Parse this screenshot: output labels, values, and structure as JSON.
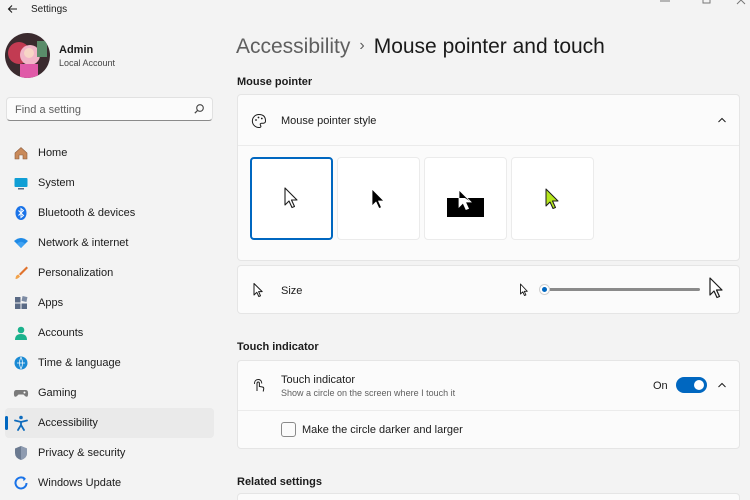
{
  "window": {
    "title": "Settings"
  },
  "user": {
    "name": "Admin",
    "account_type": "Local Account"
  },
  "search": {
    "placeholder": "Find a setting"
  },
  "sidebar": {
    "items": [
      {
        "label": "Home",
        "icon": "home-icon",
        "color": "#c2703d"
      },
      {
        "label": "System",
        "icon": "system-icon",
        "color": "#0f9ed5"
      },
      {
        "label": "Bluetooth & devices",
        "icon": "bluetooth-icon",
        "color": "#1a73e8"
      },
      {
        "label": "Network & internet",
        "icon": "network-icon",
        "color": "#1e8ae6"
      },
      {
        "label": "Personalization",
        "icon": "personalization-icon",
        "color": "#e0722c"
      },
      {
        "label": "Apps",
        "icon": "apps-icon",
        "color": "#5a6a85"
      },
      {
        "label": "Accounts",
        "icon": "accounts-icon",
        "color": "#1bb28c"
      },
      {
        "label": "Time & language",
        "icon": "time-language-icon",
        "color": "#1a8ad4"
      },
      {
        "label": "Gaming",
        "icon": "gaming-icon",
        "color": "#7a7a7a"
      },
      {
        "label": "Accessibility",
        "icon": "accessibility-icon",
        "color": "#0f6cbd",
        "active": true
      },
      {
        "label": "Privacy & security",
        "icon": "shield-icon",
        "color": "#6b7a90"
      },
      {
        "label": "Windows Update",
        "icon": "windows-update-icon",
        "color": "#1a73e8"
      }
    ]
  },
  "breadcrumb": {
    "parent": "Accessibility",
    "separator": "›",
    "current": "Mouse pointer and touch"
  },
  "sections": {
    "mouse_pointer": {
      "heading": "Mouse pointer",
      "style_card_title": "Mouse pointer style",
      "pointer_styles": [
        "white",
        "black",
        "inverted",
        "custom"
      ],
      "selected_style": "white",
      "custom_color": "#b5e61d",
      "size_label": "Size",
      "size_level": 0.03
    },
    "touch_indicator": {
      "heading": "Touch indicator",
      "title": "Touch indicator",
      "description": "Show a circle on the screen where I touch it",
      "state_label": "On",
      "enabled": true,
      "checkbox_label": "Make the circle darker and larger",
      "checkbox_checked": false
    },
    "related": {
      "heading": "Related settings"
    }
  },
  "colors": {
    "accent": "#0067c0"
  }
}
